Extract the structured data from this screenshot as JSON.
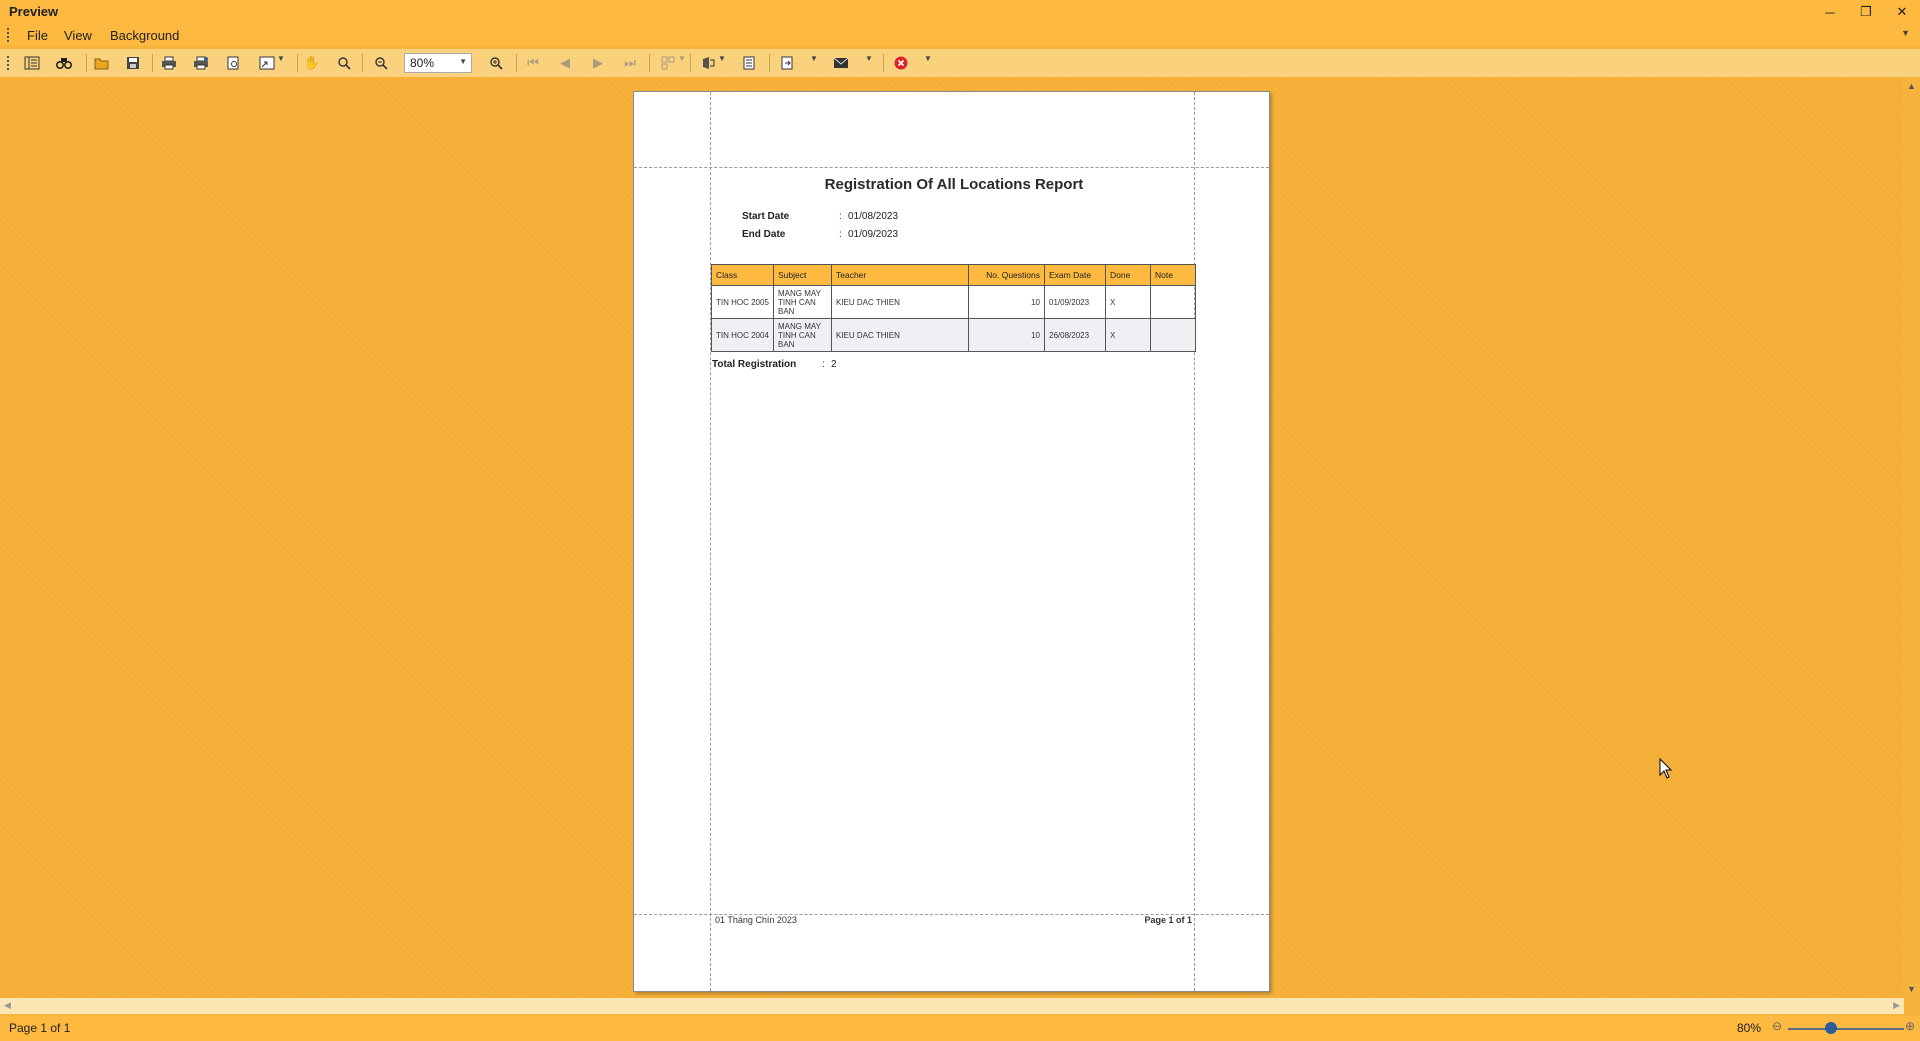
{
  "window": {
    "title": "Preview",
    "controls": {
      "minimize": "─",
      "restore": "❐",
      "close": "✕"
    }
  },
  "menu": {
    "items": [
      "File",
      "View",
      "Background"
    ]
  },
  "toolbar": {
    "zoom_value": "80%",
    "icons": [
      "document-map-icon",
      "search-icon",
      "open-icon",
      "save-icon",
      "print-icon",
      "quick-print-icon",
      "page-setup-icon",
      "scale-icon",
      "hand-tool-icon",
      "magnifier-icon",
      "zoom-out-icon",
      "zoom-in-icon",
      "first-page-icon",
      "previous-page-icon",
      "next-page-icon",
      "last-page-icon",
      "multiple-pages-icon",
      "background-color-icon",
      "watermark-icon",
      "export-icon",
      "send-email-icon",
      "close-preview-icon"
    ]
  },
  "report": {
    "title": "Registration Of All Locations Report",
    "params": [
      {
        "label": "Start Date",
        "sep": ":",
        "value": "01/08/2023"
      },
      {
        "label": "End Date",
        "sep": ":",
        "value": "01/09/2023"
      }
    ],
    "columns": [
      "Class",
      "Subject",
      "Teacher",
      "No. Questions",
      "Exam Date",
      "Done",
      "Note"
    ],
    "rows": [
      {
        "class": "TIN HOC 2005",
        "subject": "MANG MAY TINH CAN BAN",
        "teacher": "KIEU DAC THIEN",
        "questions": "10",
        "exam_date": "01/09/2023",
        "done": "X",
        "note": ""
      },
      {
        "class": "TIN HOC 2004",
        "subject": "MANG MAY TINH CAN BAN",
        "teacher": "KIEU DAC THIEN",
        "questions": "10",
        "exam_date": "26/08/2023",
        "done": "X",
        "note": ""
      }
    ],
    "total_label": "Total Registration",
    "total_sep": ":",
    "total_value": "2",
    "footer_date": "01 Tháng Chín 2023",
    "footer_page": "Page 1 of 1"
  },
  "status": {
    "page": "Page 1 of 1",
    "zoom": "80%",
    "zoom_level_percent": 80
  },
  "colors": {
    "theme": "#FDB940",
    "workspace": "#F6B23B",
    "header_fill": "#FDB940"
  }
}
